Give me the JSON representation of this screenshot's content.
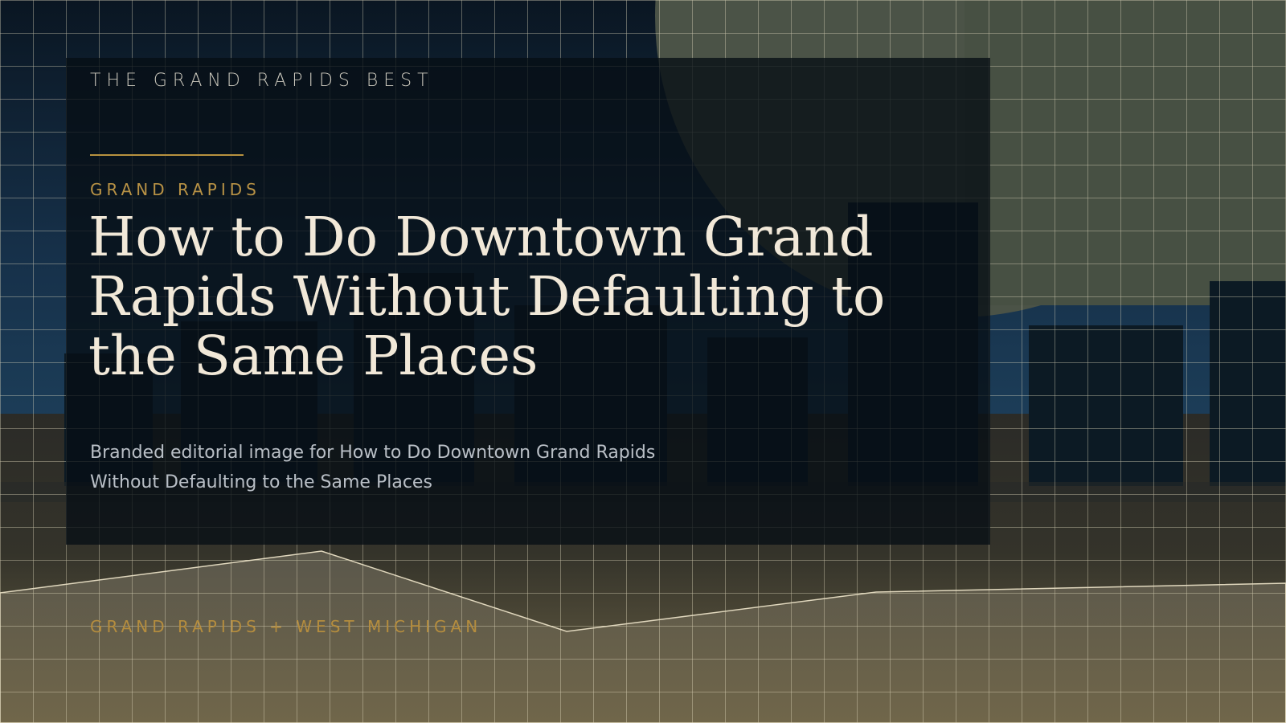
{
  "brand": "THE GRAND RAPIDS BEST",
  "kicker": "GRAND RAPIDS",
  "title": "How to Do Downtown Grand Rapids Without Defaulting to the Same Places",
  "description": "Branded editorial image for How to Do Downtown Grand Rapids Without Defaulting to the Same Places",
  "footer_tag": "GRAND RAPIDS + WEST MICHIGAN",
  "colors": {
    "sky_top": "#0a1622",
    "sky_bottom": "#1a3a55",
    "ground_top": "#2a2a24",
    "ground_bottom": "#6e6446",
    "accent_gold": "#b8923f",
    "title_cream": "#f1e8d8",
    "grid_line": "#e9e1c4"
  }
}
